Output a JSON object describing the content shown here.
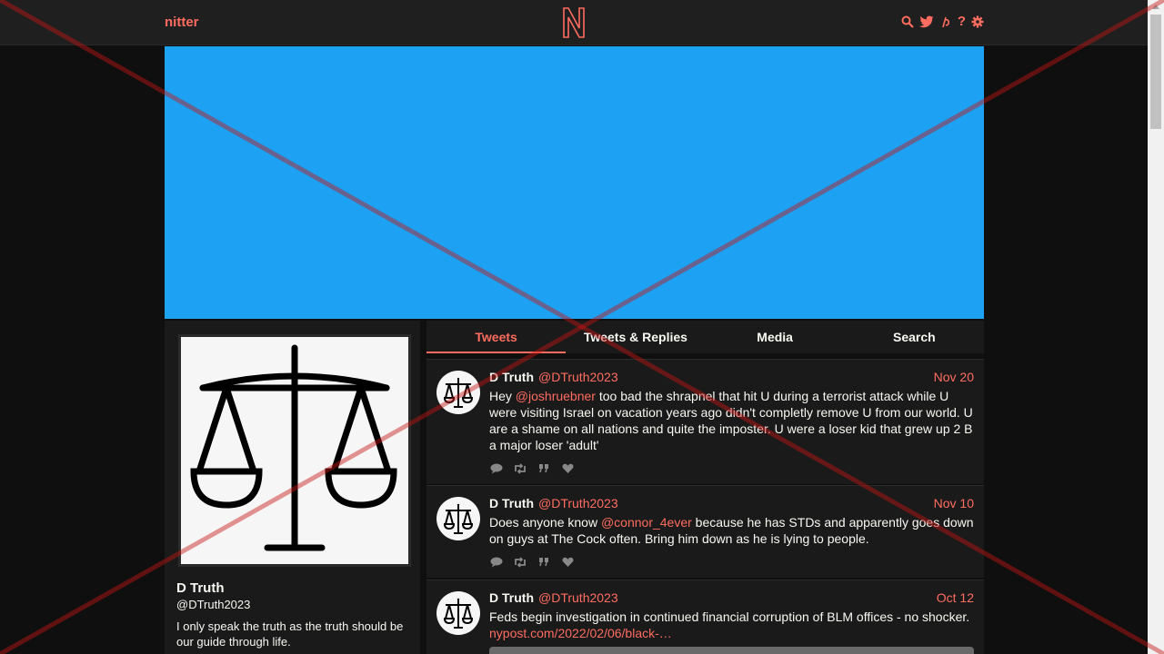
{
  "nav": {
    "logo_text": "nitter",
    "icons": [
      "search-icon",
      "twitter-bird-icon",
      "rss-icon",
      "help-icon",
      "gear-icon"
    ],
    "help_glyph": "?"
  },
  "colors": {
    "accent": "#ff6c60",
    "banner": "#1da1f2",
    "background": "#0f0f0f",
    "card": "#1a1a1a"
  },
  "profile": {
    "name": "D Truth",
    "handle": "@DTruth2023",
    "bio": "I only speak the truth as the truth should be our guide through life."
  },
  "tabs": [
    {
      "label": "Tweets",
      "active": true
    },
    {
      "label": "Tweets & Replies",
      "active": false
    },
    {
      "label": "Media",
      "active": false
    },
    {
      "label": "Search",
      "active": false
    }
  ],
  "tweets": [
    {
      "fullname": "D Truth",
      "username": "@DTruth2023",
      "date": "Nov 20",
      "text_before": "Hey ",
      "mention": "@joshruebner",
      "text_after": " too bad the shrapnel that hit U during a terrorist attack while U were visiting Israel on vacation years ago didn't completly remove U from our world. U are a shame on all nations and quite the imposter.  U were a loser kid that grew up 2 B a major loser 'adult'"
    },
    {
      "fullname": "D Truth",
      "username": "@DTruth2023",
      "date": "Nov 10",
      "text_before": "Does anyone know ",
      "mention": "@connor_4ever",
      "text_after": " because he has STDs and apparently goes down on guys at The Cock often. Bring him down as he is lying to people."
    },
    {
      "fullname": "D Truth",
      "username": "@DTruth2023",
      "date": "Oct 12",
      "text_before": "Feds begin investigation in continued financial corruption of BLM offices - no shocker.",
      "link": "nypost.com/2022/02/06/black-…"
    }
  ]
}
